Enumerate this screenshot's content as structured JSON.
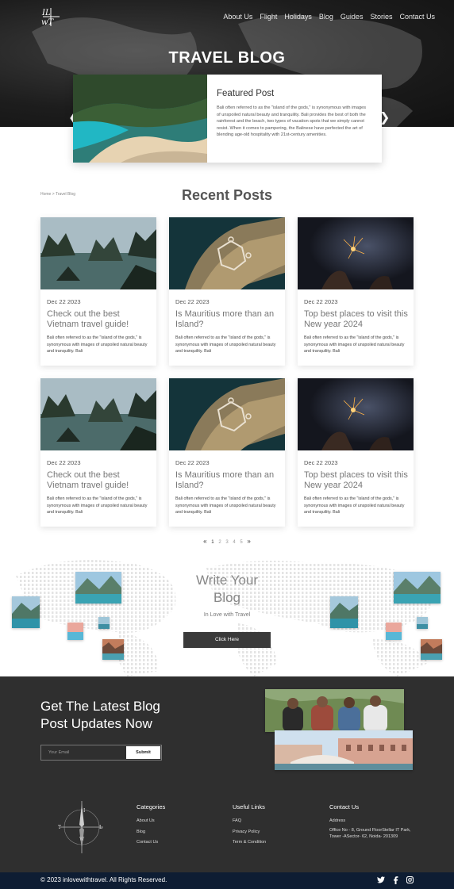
{
  "nav": {
    "items": [
      "About Us",
      "Flight",
      "Holidays",
      "Blog",
      "Guides",
      "Stories",
      "Contact Us"
    ]
  },
  "hero": {
    "title_light": "TRAVEL",
    "title_bold": "BLOG"
  },
  "featured": {
    "heading": "Featured Post",
    "text": "Bali often referred to as the \"island of the gods,\" is synonymous with images of unspoiled natural beauty and tranquility. Bali provides the best of both the rainforest and the beach, two types of vacation spots that we simply cannot resist. When it comes to pampering, the Balinese have perfected the art of blending age-old hospitality with 21st-century amenities.",
    "prev_icon": "chevron-left-icon",
    "next_icon": "chevron-right-icon"
  },
  "breadcrumb": "Home > Travel Blog",
  "recent_title": "Recent Posts",
  "posts": [
    {
      "date": "Dec 22 2023",
      "title": "Check out the best Vietnam travel guide!",
      "excerpt": "Bali often referred to as the \"island of the gods,\" is synonymous with images of unspoiled natural beauty and tranquility. Bali"
    },
    {
      "date": "Dec 22 2023",
      "title": "Is Mauritius more than an Island?",
      "excerpt": "Bali often referred to as the \"island of the gods,\" is synonymous with images of unspoiled natural beauty and tranquility. Bali"
    },
    {
      "date": "Dec 22 2023",
      "title": "Top best places to visit this New year 2024",
      "excerpt": "Bali often referred to as the \"island of the gods,\" is synonymous with images of unspoiled natural beauty and tranquility. Bali"
    },
    {
      "date": "Dec 22 2023",
      "title": "Check out the best Vietnam travel guide!",
      "excerpt": "Bali often referred to as the \"island of the gods,\" is synonymous with images of unspoiled natural beauty and tranquility. Bali"
    },
    {
      "date": "Dec 22 2023",
      "title": "Is Mauritius more than an Island?",
      "excerpt": "Bali often referred to as the \"island of the gods,\" is synonymous with images of unspoiled natural beauty and tranquility. Bali"
    },
    {
      "date": "Dec 22 2023",
      "title": "Top best places to visit this New year 2024",
      "excerpt": "Bali often referred to as the \"island of the gods,\" is synonymous with images of unspoiled natural beauty and tranquility. Bali"
    }
  ],
  "pagination": {
    "prev": "«",
    "pages": [
      "1",
      "2",
      "3",
      "4",
      "5"
    ],
    "current": "1",
    "next": "»"
  },
  "write": {
    "line1": "Write Your",
    "line2": "Blog",
    "subtitle": "In Love with Travel",
    "button": "Click Here"
  },
  "newsletter": {
    "line1": "Get The Latest Blog",
    "line2": "Post Updates Now",
    "email_placeholder": "Your Email",
    "submit": "Submit"
  },
  "footer": {
    "categories": {
      "heading": "Categories",
      "links": [
        "About Us",
        "Blog",
        "Contact Us"
      ]
    },
    "useful": {
      "heading": "Useful Links",
      "links": [
        "FAQ",
        "Privacy Policy",
        "Term & Condition"
      ]
    },
    "contact": {
      "heading": "Contact Us",
      "label": "Address",
      "address": "Office No - 8, Ground FloorStellar IT Park, Tower -ASector- 62, Noida- 201309"
    },
    "copyright": "© 2023 inlovewithtravel. All Rights Reserved.",
    "social": [
      "twitter-icon",
      "facebook-icon",
      "instagram-icon"
    ]
  },
  "colors": {
    "footer_dark": "#2f2f2f",
    "bottom_bar": "#0e1d33",
    "button_dark": "#3a3a3a"
  }
}
